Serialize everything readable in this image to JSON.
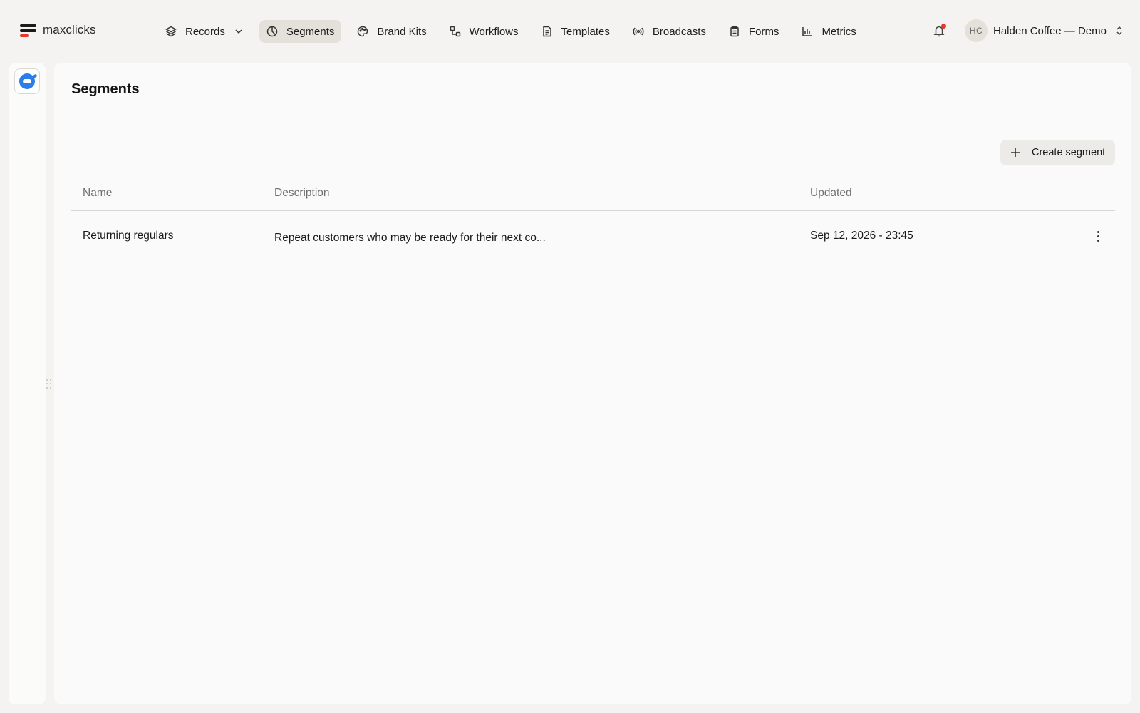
{
  "app": {
    "brand": "maxclicks"
  },
  "nav": {
    "items": [
      {
        "label": "Records",
        "icon": "layers-icon",
        "has_dropdown": true,
        "active": false
      },
      {
        "label": "Segments",
        "icon": "pie-chart-icon",
        "active": true
      },
      {
        "label": "Brand Kits",
        "icon": "palette-icon",
        "active": false
      },
      {
        "label": "Workflows",
        "icon": "workflow-icon",
        "active": false
      },
      {
        "label": "Templates",
        "icon": "document-icon",
        "active": false
      },
      {
        "label": "Broadcasts",
        "icon": "broadcast-icon",
        "active": false
      },
      {
        "label": "Forms",
        "icon": "clipboard-icon",
        "active": false
      },
      {
        "label": "Metrics",
        "icon": "bar-chart-icon",
        "active": false
      }
    ]
  },
  "header": {
    "notifications_unread": true,
    "account": {
      "initials": "HC",
      "name": "Halden Coffee — Demo"
    }
  },
  "page": {
    "title": "Segments",
    "create_button": "Create segment"
  },
  "table": {
    "columns": [
      "Name",
      "Description",
      "Updated"
    ],
    "rows": [
      {
        "name": "Returning regulars",
        "description": "Repeat customers who may be ready for their next co...",
        "updated": "Sep 12, 2026 - 23:45"
      }
    ]
  },
  "colors": {
    "background": "#f4f3f1",
    "panel": "#fafafa",
    "active_nav": "#e4e0da",
    "accent_red": "#e5382b",
    "app_icon_blue": "#2b7de9"
  }
}
